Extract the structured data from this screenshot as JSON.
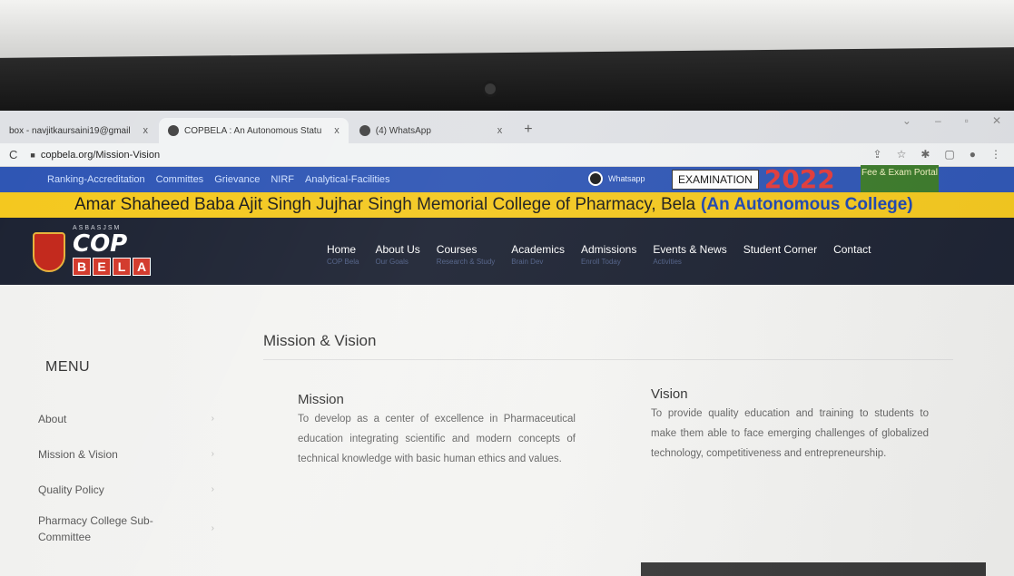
{
  "browser": {
    "tabs": [
      {
        "label": "box - navjitkaursaini19@gmail",
        "close": "x"
      },
      {
        "label": "COPBELA : An Autonomous Statu",
        "close": "x"
      },
      {
        "label": "(4) WhatsApp",
        "close": "x"
      }
    ],
    "new_tab": "+",
    "url": "copbela.org/Mission-Vision"
  },
  "topbar": {
    "links": [
      "Ranking-Accreditation",
      "Committes",
      "Grievance",
      "NIRF",
      "Analytical-Facilities"
    ],
    "whatsapp": "Whatsapp",
    "exam_label": "EXAMINATION",
    "exam_year": "2022",
    "fee_portal": "Fee & Exam Portal"
  },
  "banner": {
    "college_name": "Amar Shaheed Baba Ajit Singh Jujhar Singh Memorial College of Pharmacy, Bela",
    "college_suffix": "(An Autonomous College)"
  },
  "logo": {
    "small_text": "ASBASJSM",
    "cop": "COP",
    "bela": [
      "B",
      "E",
      "L",
      "A"
    ]
  },
  "nav": {
    "items": [
      {
        "label": "Home",
        "sub": "COP Bela"
      },
      {
        "label": "About Us",
        "sub": "Our Goals"
      },
      {
        "label": "Courses",
        "sub": "Research & Study"
      },
      {
        "label": "Academics",
        "sub": "Brain Dev"
      },
      {
        "label": "Admissions",
        "sub": "Enroll Today"
      },
      {
        "label": "Events & News",
        "sub": "Activities"
      },
      {
        "label": "Student Corner",
        "sub": ""
      },
      {
        "label": "Contact",
        "sub": ""
      }
    ]
  },
  "sidebar": {
    "title": "MENU",
    "items": [
      "About",
      "Mission & Vision",
      "Quality Policy",
      "Pharmacy College Sub-Committee"
    ]
  },
  "main": {
    "title": "Mission & Vision",
    "mission": {
      "heading": "Mission",
      "text": "To develop as a center of excellence in Pharmaceutical education integrating scientific and modern concepts of technical knowledge with basic human ethics and values."
    },
    "vision": {
      "heading": "Vision",
      "text": "To provide quality education and training to students to make them able to face emerging challenges of globalized technology, competitiveness and entrepreneurship."
    }
  }
}
